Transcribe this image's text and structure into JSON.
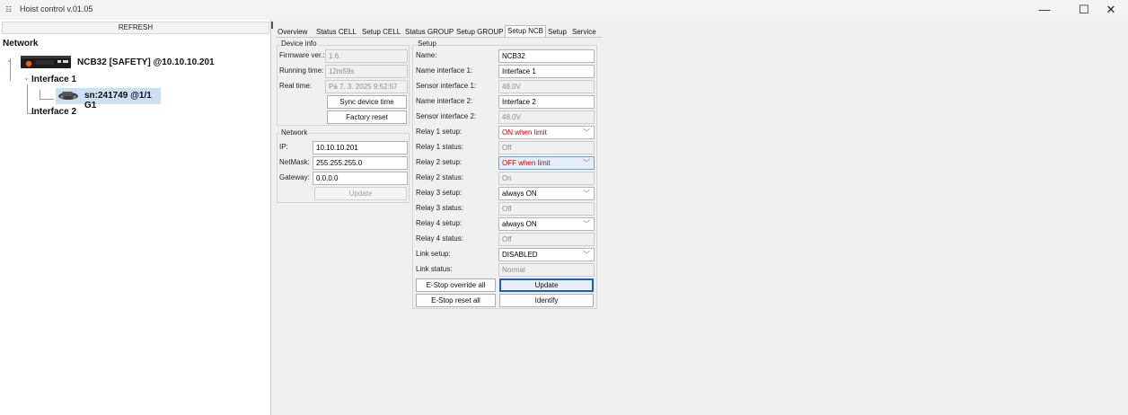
{
  "window": {
    "title": "Hoist control v.01.05",
    "app_icon": "hoist-icon",
    "minimize": "—",
    "maximize": "☐",
    "close": "✕"
  },
  "left": {
    "refresh_label": "REFRESH",
    "tree": {
      "root": "Network",
      "device": "NCB32 [SAFETY] @10.10.10.201",
      "interface1": "Interface 1",
      "node": "sn:241749 @1/1 G1",
      "interface2": "Interface 2"
    }
  },
  "tabs": [
    "Overview",
    "Status CELL",
    "Setup CELL",
    "Status GROUP",
    "Setup GROUP",
    "Setup NCB",
    "Setup",
    "Service"
  ],
  "device_info": {
    "legend": "Device info",
    "firmware_label": "Firmware ver.:",
    "firmware_value": "1.6.",
    "running_label": "Running time:",
    "running_value": "12m59s",
    "realtime_label": "Real time:",
    "realtime_value": "Pá 7. 3. 2025 9:52:57",
    "sync_button": "Sync device time",
    "factory_button": "Factory reset"
  },
  "network": {
    "legend": "Network",
    "ip_label": "IP:",
    "ip_value": "10.10.10.201",
    "mask_label": "NetMask:",
    "mask_value": "255.255.255.0",
    "gateway_label": "Gateway:",
    "gateway_value": "0.0.0.0",
    "update_button": "Update"
  },
  "setup": {
    "legend": "Setup",
    "rows": [
      {
        "label": "Name:",
        "value": "NCB32"
      },
      {
        "label": "Name interface 1:",
        "value": "Interface 1"
      },
      {
        "label": "Sensor interface 1:",
        "value": "48.0V"
      },
      {
        "label": "Name interface 2:",
        "value": "Interface 2"
      },
      {
        "label": "Sensor interface 2:",
        "value": "48.0V"
      },
      {
        "label": "Relay 1 setup:",
        "value": "ON when limit"
      },
      {
        "label": "Relay 1 status:",
        "value": "Off"
      },
      {
        "label": "Relay 2 setup:",
        "value": "OFF when limit"
      },
      {
        "label": "Relay 2 status:",
        "value": "On"
      },
      {
        "label": "Relay 3 setup:",
        "value": "always ON"
      },
      {
        "label": "Relay 3 status:",
        "value": "Off"
      },
      {
        "label": "Relay 4 setup:",
        "value": "always ON"
      },
      {
        "label": "Relay 4 status:",
        "value": "Off"
      },
      {
        "label": "Link setup:",
        "value": "DISABLED"
      },
      {
        "label": "Link status:",
        "value": "Normal"
      }
    ],
    "estop_override_button": "E-Stop override all",
    "estop_reset_button": "E-Stop reset all",
    "update_button": "Update",
    "identify_button": "Identify"
  },
  "colors": {
    "selection": "#cce0f5",
    "warning_text": "#d40000"
  },
  "icons": {
    "dropdown": "chevron-down-icon"
  }
}
